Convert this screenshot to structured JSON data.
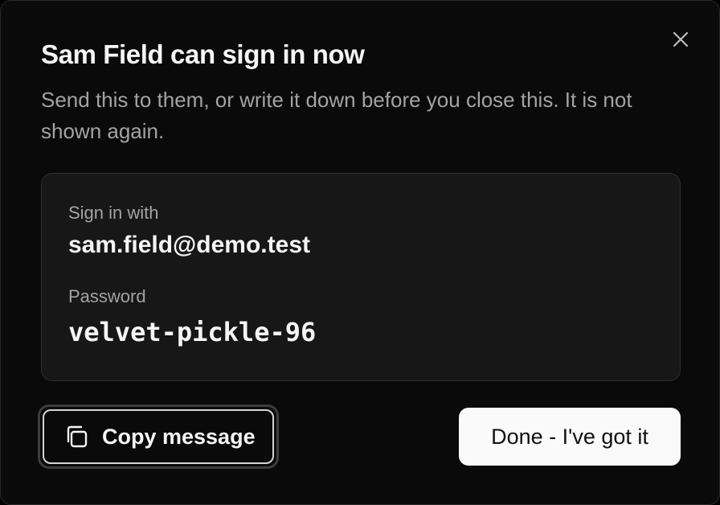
{
  "dialog": {
    "title": "Sam Field can sign in now",
    "subtitle": "Send this to them, or write it down before you close this. It is not shown again.",
    "close_icon": "close-icon"
  },
  "credentials": {
    "signin_label": "Sign in with",
    "email": "sam.field@demo.test",
    "password_label": "Password",
    "password": "velvet-pickle-96"
  },
  "actions": {
    "copy_label": "Copy message",
    "copy_icon": "copy-icon",
    "done_label": "Done - I've got it"
  },
  "colors": {
    "background": "#0a0a0a",
    "panel": "#171717",
    "text_primary": "#f5f5f5",
    "text_muted": "#a3a3a3",
    "primary_button": "#fafafa"
  }
}
